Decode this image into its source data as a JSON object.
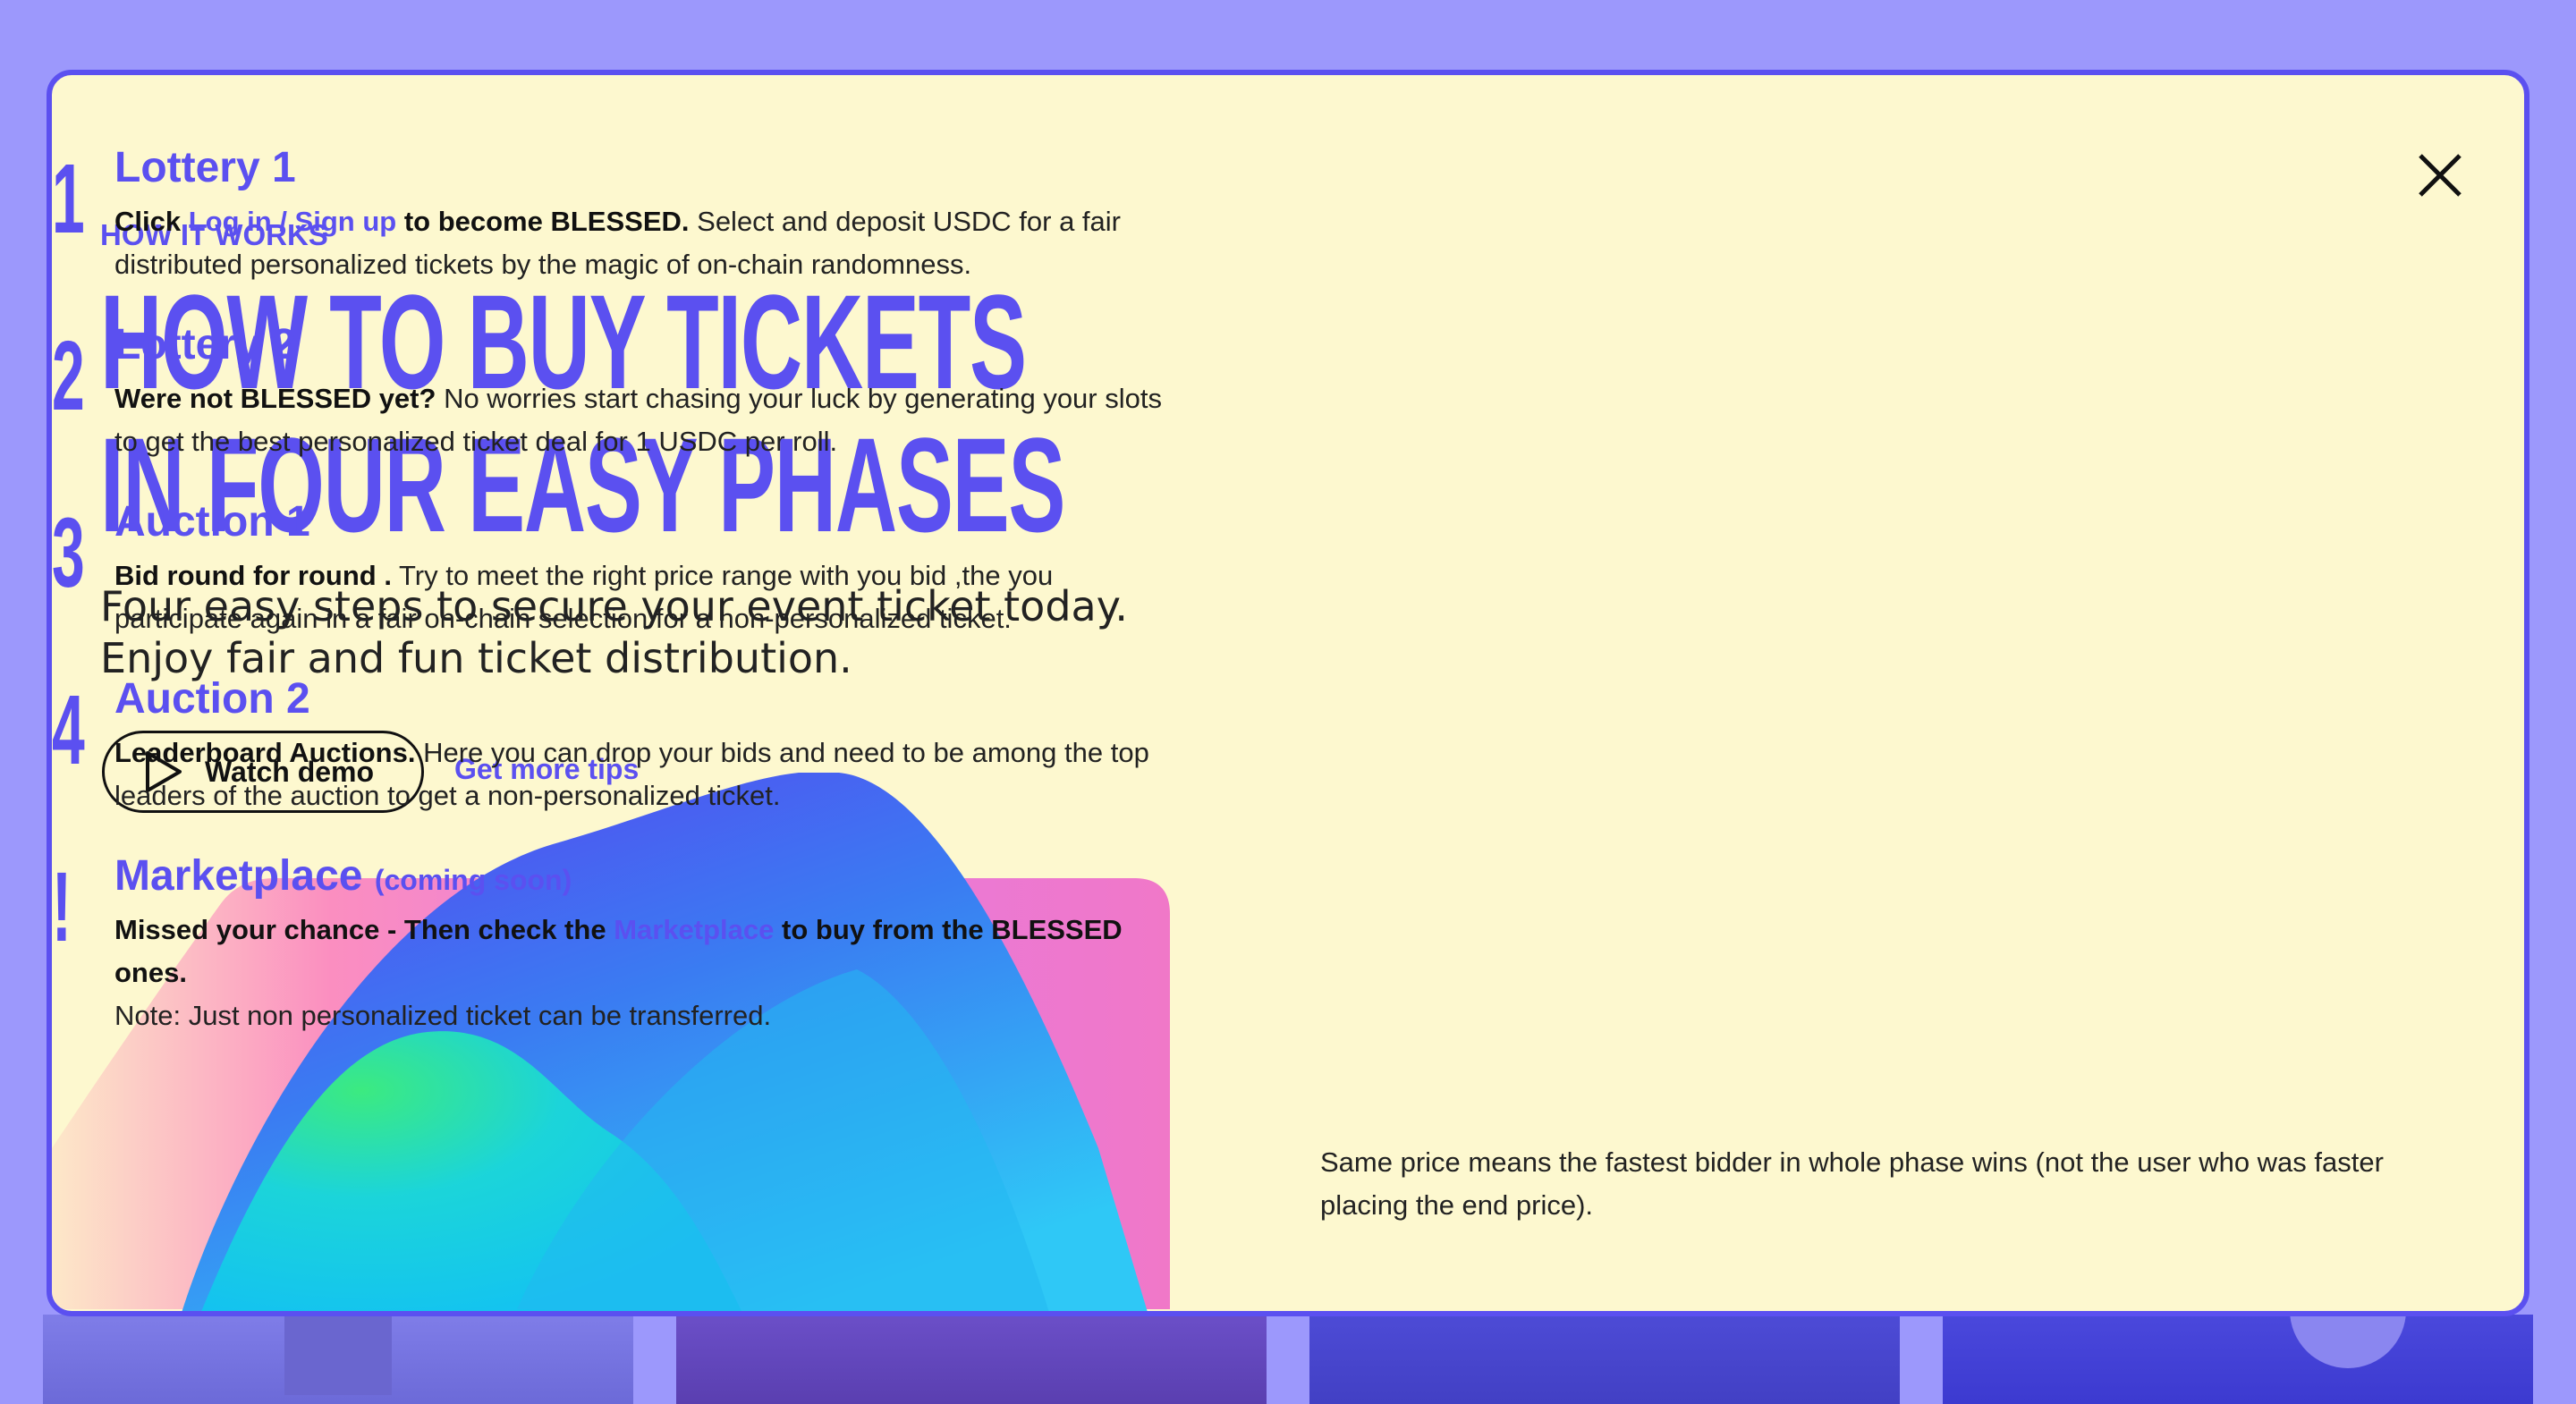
{
  "modal": {
    "eyebrow": "HOW IT WORKS",
    "headline_line1": "HOW TO BUY TICKETS",
    "headline_line2": "IN FOUR EASY PHASES",
    "lead_line1": "Four easy steps to secure your event ticket today.",
    "lead_line2": "Enjoy fair and fun ticket distribution.",
    "watch_demo_label": "Watch demo",
    "get_tips_label": "Get more tips",
    "close_icon": "close-icon",
    "play_icon": "play-icon"
  },
  "steps": [
    {
      "num": "1",
      "title": "Lottery 1",
      "b_click": "Click",
      "link": "Log in / Sign up",
      "b_after": "to become BLESSED.",
      "text": "Select and deposit USDC for a fair distributed personalized tickets by the magic of on-chain randomness."
    },
    {
      "num": "2",
      "title": "Lottery 2",
      "bold": "Were not BLESSED yet?",
      "text": "No worries start chasing your luck by generating your slots to get the best personalized ticket deal for 1 USDC per roll."
    },
    {
      "num": "3",
      "title": "Auction 1",
      "bold": "Bid round for round .",
      "text": "Try to meet the right price range with you bid ,the you participate again in a fair on-chain selection for a non-personalized  ticket."
    },
    {
      "num": "4",
      "title": "Auction 2",
      "bold": "Leaderboard Auctions.",
      "text": "Here you can drop your bids and need to be among the top leaders of the auction to get a non-personalized  ticket."
    },
    {
      "num": "!",
      "title": "Marketplace",
      "title_suffix": "(coming soon)",
      "b_before": "Missed your chance - Then check the",
      "link": "Marketplace",
      "b_after": "to buy from the BLESSED ones.",
      "note": "Note: Just non personalized ticket can be transferred."
    }
  ],
  "footnote": "Same price means the fastest bidder in whole phase wins (not the user who was faster placing the end price).",
  "colors": {
    "accent": "#5b50f0",
    "modal_bg": "#fdf8cf",
    "page_bg": "#9c98fc"
  }
}
